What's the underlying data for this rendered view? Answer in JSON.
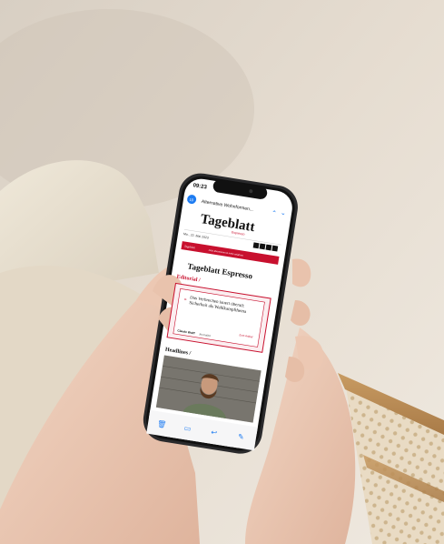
{
  "status": {
    "time": "09:23"
  },
  "mail": {
    "subject": "Alternative Wohnformen...",
    "back_count": "10"
  },
  "newsletter": {
    "masthead": "Tageblatt",
    "masthead_sub": "Espresso",
    "date": "Mo., 22. Mai 2023",
    "banner_left": "Tageblatt",
    "banner_text": "Jetzt abonnieren & mehr erfahren",
    "title": "Tageblatt Espresso",
    "editorial_label": "Editorial /",
    "quote": "Das Verbrechen lauert überall: Sicherheit als Wahlkampfthema",
    "read_more": "Zum Artikel",
    "author": "Claude Wolff",
    "author_role": "Journalist",
    "headlines_label": "Headlines /"
  },
  "toolbar": {
    "delete_icon": "trash-icon",
    "folder_icon": "folder-icon",
    "reply_icon": "reply-icon",
    "compose_icon": "compose-icon"
  },
  "colors": {
    "accent": "#c8102e",
    "ios_blue": "#1e7cf2",
    "paper": "#ffffff"
  }
}
